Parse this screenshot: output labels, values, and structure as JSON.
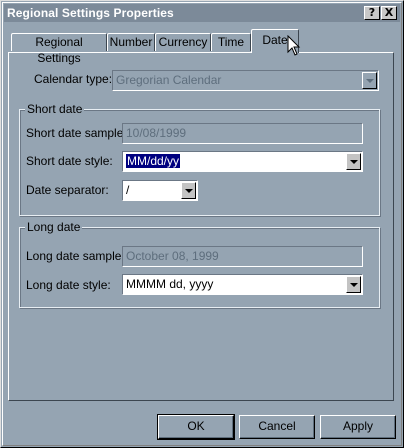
{
  "window": {
    "title": "Regional Settings Properties"
  },
  "titlebar_buttons": {
    "help": "?",
    "close": "X"
  },
  "tabs": [
    {
      "label": "Regional Settings"
    },
    {
      "label": "Number"
    },
    {
      "label": "Currency"
    },
    {
      "label": "Time"
    },
    {
      "label": "Date",
      "active": true
    }
  ],
  "calendar": {
    "label": "Calendar type:",
    "value": "Gregorian Calendar"
  },
  "short_date": {
    "group_title": "Short date",
    "sample_label": "Short date sample:",
    "sample_value": "10/08/1999",
    "style_label": "Short date style:",
    "style_value": "MM/dd/yy",
    "separator_label": "Date separator:",
    "separator_value": "/"
  },
  "long_date": {
    "group_title": "Long date",
    "sample_label": "Long date sample:",
    "sample_value": "October 08, 1999",
    "style_label": "Long date style:",
    "style_value": "MMMM dd, yyyy"
  },
  "buttons": {
    "ok": "OK",
    "cancel": "Cancel",
    "apply": "Apply"
  },
  "colors": {
    "title_bar": "#7c8a99",
    "dialog_face": "#95a4b2",
    "selection": "#000080"
  },
  "icons": [
    "help-icon",
    "close-icon",
    "mouse-pointer-icon"
  ]
}
